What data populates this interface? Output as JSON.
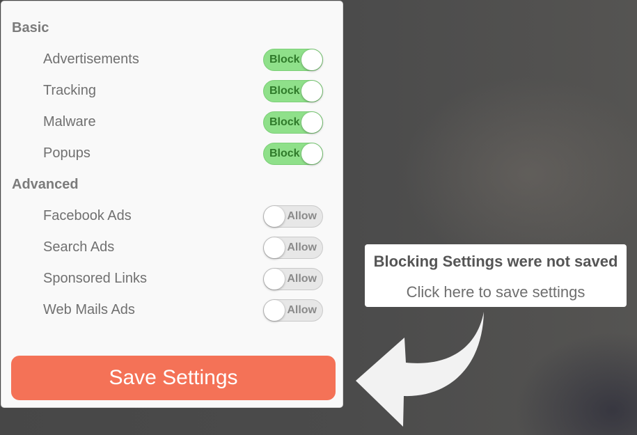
{
  "basic": {
    "title": "Basic",
    "items": [
      {
        "label": "Advertisements",
        "state": "Block"
      },
      {
        "label": "Tracking",
        "state": "Block"
      },
      {
        "label": "Malware",
        "state": "Block"
      },
      {
        "label": "Popups",
        "state": "Block"
      }
    ]
  },
  "advanced": {
    "title": "Advanced",
    "items": [
      {
        "label": "Facebook Ads",
        "state": "Allow"
      },
      {
        "label": "Search Ads",
        "state": "Allow"
      },
      {
        "label": "Sponsored Links",
        "state": "Allow"
      },
      {
        "label": "Web Mails Ads",
        "state": "Allow"
      }
    ]
  },
  "save_button": {
    "label": "Save Settings"
  },
  "tooltip": {
    "title": "Blocking Settings were not saved",
    "subtitle": "Click here to save settings"
  },
  "colors": {
    "toggle_on": "#8fe08a",
    "toggle_off": "#e7e7e7",
    "save_button": "#f47257",
    "arrow": "#f2f2f2"
  },
  "icons": {
    "pointer_arrow": "curved-arrow-left-icon"
  }
}
